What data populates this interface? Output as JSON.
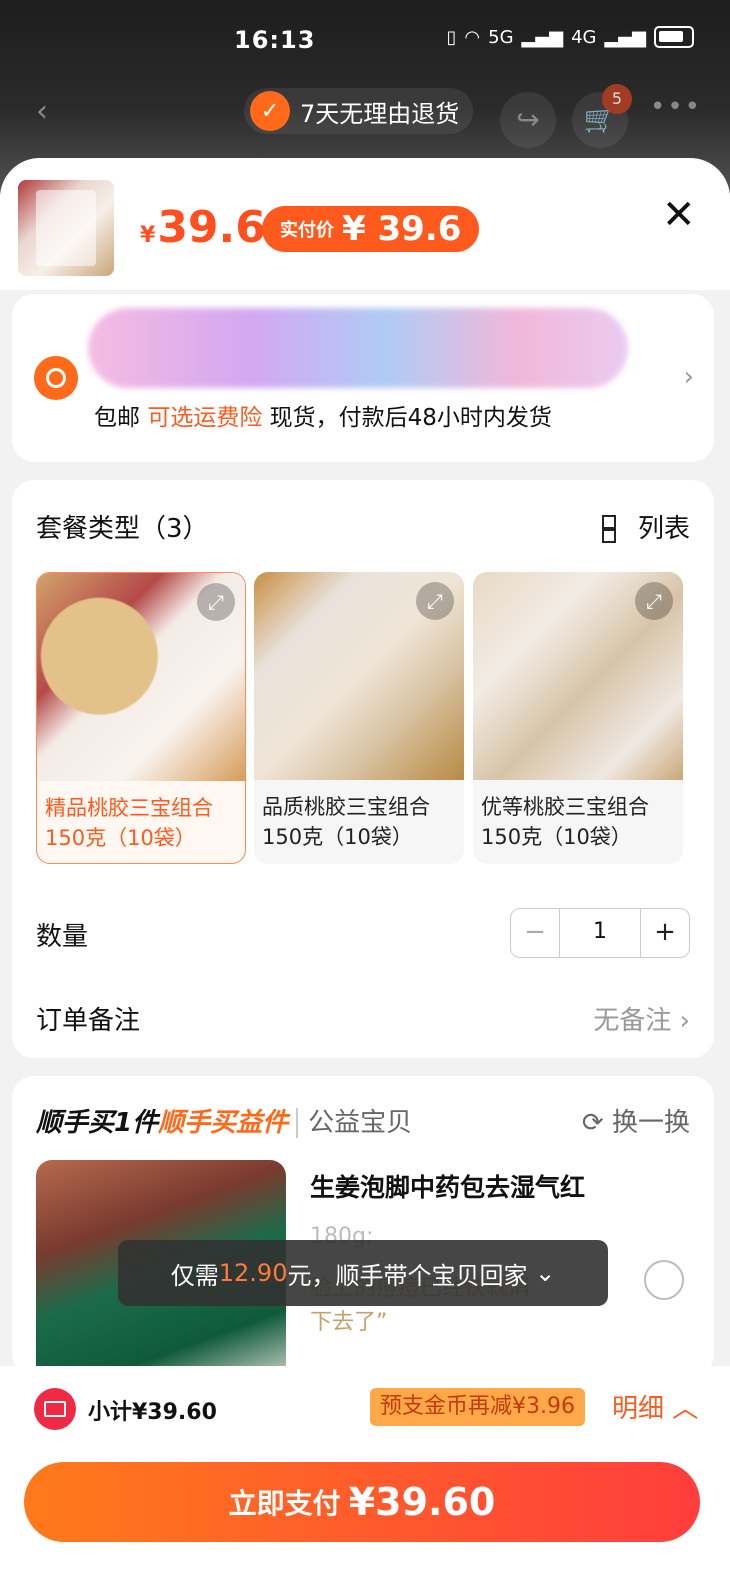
{
  "status": {
    "time": "16:13",
    "signal1": "5G",
    "signal2": "4G"
  },
  "nav": {
    "refund_badge": "7天无理由退货",
    "cart_count": "5"
  },
  "product": {
    "currency": "¥",
    "price": "39.6",
    "paid_label": "实付价",
    "paid_value": "¥ 39.6"
  },
  "address": {
    "shipping_free": "包邮",
    "insurance": "可选运费险",
    "delivery": "现货，付款后48小时内发货"
  },
  "options": {
    "title": "套餐类型（3）",
    "list_label": "列表",
    "items": [
      {
        "line1": "精品桃胶三宝组合",
        "line2": "150克（10袋）"
      },
      {
        "line1": "品质桃胶三宝组合",
        "line2": "150克（10袋）"
      },
      {
        "line1": "优等桃胶三宝组合",
        "line2": "150克（10袋）"
      }
    ],
    "quantity_label": "数量",
    "quantity_value": "1",
    "minus": "−",
    "plus": "+",
    "note_label": "订单备注",
    "note_value": "无备注"
  },
  "recommend": {
    "title_a": "顺手买1件",
    "title_b": "顺手买益件",
    "title_c": "公益宝贝",
    "swap": "换一换",
    "name": "生姜泡脚中药包去湿气红",
    "spec": "180g;",
    "desc": "脸上的痘痘已经快就消下去了”",
    "toast_pre": "仅需",
    "toast_price": "12.90",
    "toast_post": "元，顺手带个宝贝回家"
  },
  "bottom": {
    "subtotal": "小计¥39.60",
    "coins": "预支金币再减¥3.96",
    "detail": "明细",
    "pay_label": "立即支付",
    "pay_amount": "¥39.60"
  },
  "colors": {
    "accent": "#ff5a1e",
    "pay_start": "#ff7a1a",
    "pay_end": "#ff3d3d"
  }
}
